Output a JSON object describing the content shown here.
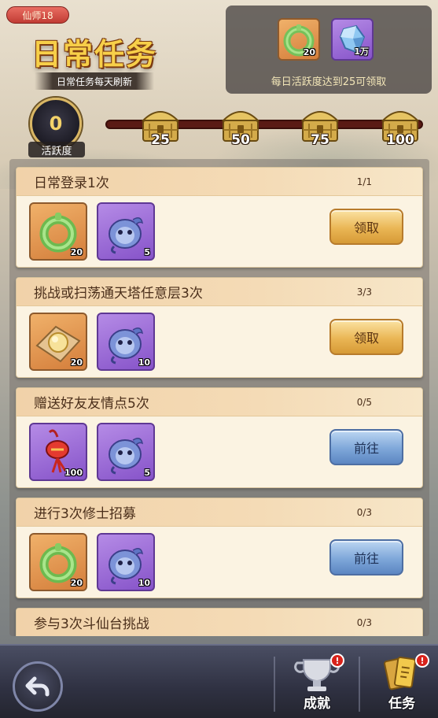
{
  "header": {
    "rank_badge": "仙师18",
    "title": "日常任务",
    "subtitle": "日常任务每天刷新"
  },
  "reward_panel": {
    "items": [
      {
        "icon": "jade-ring-icon",
        "count": "20"
      },
      {
        "icon": "blue-crystal-icon",
        "count": "1万"
      }
    ],
    "caption": "每日活跃度达到25可领取"
  },
  "activity": {
    "value": "0",
    "label": "活跃度",
    "progress": 0,
    "milestones": [
      "25",
      "50",
      "75",
      "100"
    ]
  },
  "tasks": [
    {
      "title": "日常登录1次",
      "progress": "1/1",
      "items": [
        {
          "icon": "jade-ring-icon",
          "count": "20",
          "bg": "orange"
        },
        {
          "icon": "spirit-creature-icon",
          "count": "5",
          "bg": "purple"
        }
      ],
      "button": "领取",
      "button_type": "claim"
    },
    {
      "title": "挑战或扫荡通天塔任意层3次",
      "progress": "3/3",
      "items": [
        {
          "icon": "pearl-on-cloth-icon",
          "count": "20",
          "bg": "orange"
        },
        {
          "icon": "spirit-creature-icon",
          "count": "10",
          "bg": "purple"
        }
      ],
      "button": "领取",
      "button_type": "claim"
    },
    {
      "title": "赠送好友友情点5次",
      "progress": "0/5",
      "items": [
        {
          "icon": "red-knot-charm-icon",
          "count": "100",
          "bg": "purple"
        },
        {
          "icon": "spirit-creature-icon",
          "count": "5",
          "bg": "purple"
        }
      ],
      "button": "前往",
      "button_type": "go"
    },
    {
      "title": "进行3次修士招募",
      "progress": "0/3",
      "items": [
        {
          "icon": "jade-ring-icon",
          "count": "20",
          "bg": "orange"
        },
        {
          "icon": "spirit-creature-icon",
          "count": "10",
          "bg": "purple"
        }
      ],
      "button": "前往",
      "button_type": "go"
    },
    {
      "title": "参与3次斗仙台挑战",
      "progress": "0/3",
      "items": [],
      "button": "",
      "button_type": "go"
    }
  ],
  "bottom_nav": {
    "tabs": [
      {
        "label": "成就",
        "icon": "trophy-icon",
        "alert": "!"
      },
      {
        "label": "任务",
        "icon": "task-scroll-icon",
        "alert": "!"
      }
    ]
  },
  "colors": {
    "accent_gold": "#e7b24a",
    "claim_button": "#eab655",
    "go_button": "#7ea7d9",
    "alert_red": "#d8231b"
  }
}
